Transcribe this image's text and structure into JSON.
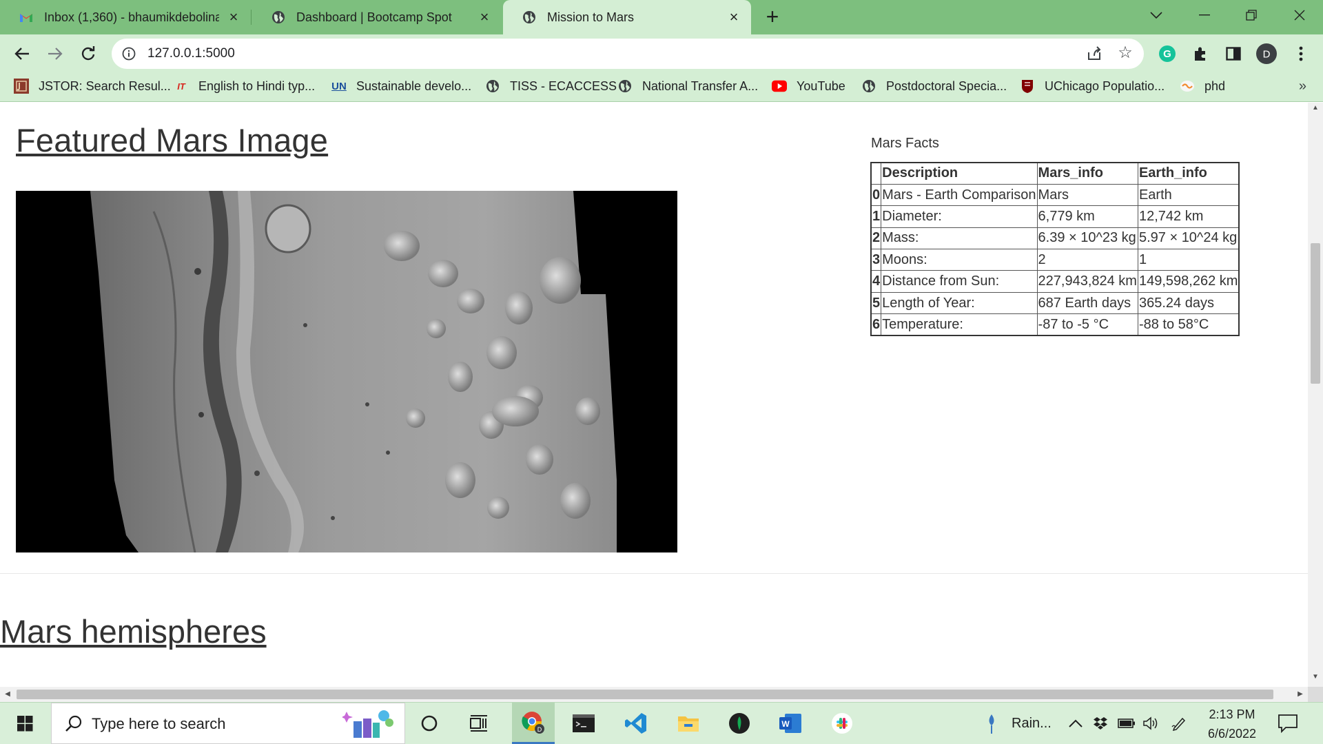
{
  "browser": {
    "tabs": [
      {
        "title": "Inbox (1,360) - bhaumikdebolina",
        "icon": "gmail-icon"
      },
      {
        "title": "Dashboard | Bootcamp Spot",
        "icon": "globe-icon"
      },
      {
        "title": "Mission to Mars",
        "icon": "globe-icon",
        "active": true
      }
    ],
    "url": "127.0.0.1:5000",
    "profile_initial": "D",
    "bookmarks": [
      {
        "label": "JSTOR: Search Resul...",
        "icon": "jstor-icon"
      },
      {
        "label": "English to Hindi typ...",
        "icon": "it-icon",
        "icon_text": "IT"
      },
      {
        "label": "Sustainable develo...",
        "icon": "un-icon",
        "icon_text": "UN"
      },
      {
        "label": "TISS - ECACCESS",
        "icon": "globe-icon"
      },
      {
        "label": "National Transfer A...",
        "icon": "globe-icon"
      },
      {
        "label": "YouTube",
        "icon": "youtube-icon"
      },
      {
        "label": "Postdoctoral Specia...",
        "icon": "globe-icon"
      },
      {
        "label": "UChicago Populatio...",
        "icon": "uchicago-icon"
      },
      {
        "label": "phd",
        "icon": "folder-icon"
      }
    ],
    "bookmarks_more": "»"
  },
  "page": {
    "featured_title": "Featured Mars Image",
    "facts_label": "Mars Facts",
    "facts_headers": [
      "",
      "Description",
      "Mars_info",
      "Earth_info"
    ],
    "facts_rows": [
      [
        "0",
        "Mars - Earth Comparison",
        "Mars",
        "Earth"
      ],
      [
        "1",
        "Diameter:",
        "6,779 km",
        "12,742 km"
      ],
      [
        "2",
        "Mass:",
        "6.39 × 10^23 kg",
        "5.97 × 10^24 kg"
      ],
      [
        "3",
        "Moons:",
        "2",
        "1"
      ],
      [
        "4",
        "Distance from Sun:",
        "227,943,824 km",
        "149,598,262 km"
      ],
      [
        "5",
        "Length of Year:",
        "687 Earth days",
        "365.24 days"
      ],
      [
        "6",
        "Temperature:",
        "-87 to -5 °C",
        "-88 to 58°C"
      ]
    ],
    "hemispheres_title": "Mars hemispheres"
  },
  "taskbar": {
    "search_placeholder": "Type here to search",
    "weather": "Rain...",
    "time": "2:13 PM",
    "date": "6/6/2022"
  },
  "colors": {
    "tabstrip": "#7dbf7e",
    "toolbar": "#d4eed4",
    "taskbar": "#d9efd9"
  }
}
